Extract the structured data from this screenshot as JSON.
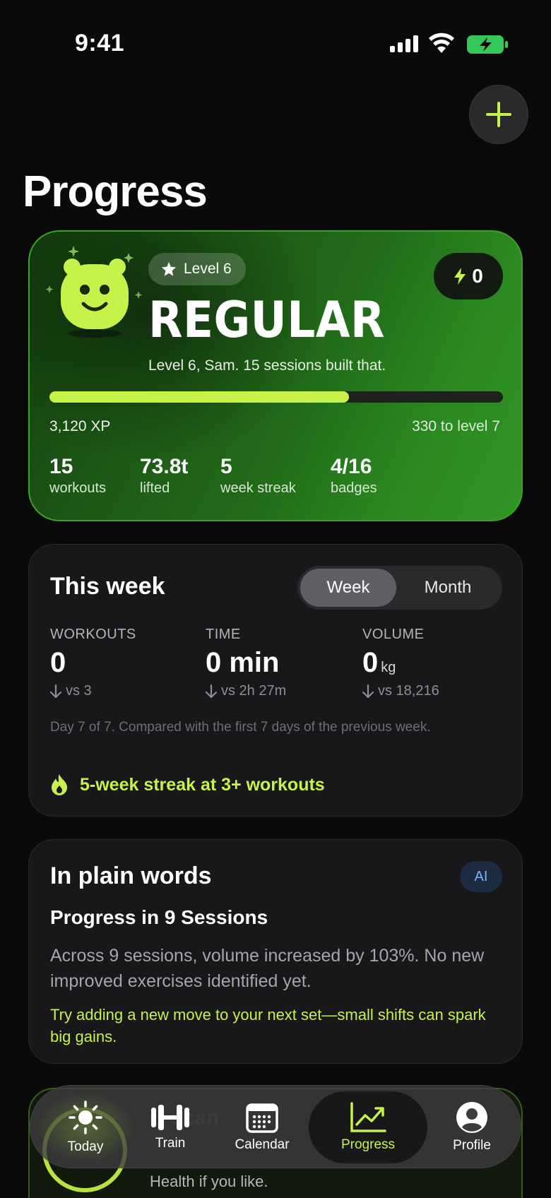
{
  "status_bar": {
    "time": "9:41"
  },
  "page": {
    "title": "Progress"
  },
  "level_card": {
    "level_label": "Level 6",
    "energy_count": "0",
    "rank": "REGULAR",
    "subtitle": "Level 6, Sam. 15 sessions built that.",
    "xp_progress_fraction": 0.66,
    "xp_text": "3,120 XP",
    "xp_to_next": "330 to level 7",
    "stats": [
      {
        "value": "15",
        "label": "workouts"
      },
      {
        "value": "73.8t",
        "label": "lifted"
      },
      {
        "value": "5",
        "label": "week streak"
      },
      {
        "value": "4/16",
        "label": "badges"
      }
    ]
  },
  "week_card": {
    "title": "This week",
    "segments": {
      "week": "Week",
      "month": "Month",
      "selected": "Week"
    },
    "metrics": [
      {
        "header": "WORKOUTS",
        "value": "0",
        "unit": "",
        "delta": "vs 3"
      },
      {
        "header": "TIME",
        "value": "0 min",
        "unit": "",
        "delta": "vs 2h 27m"
      },
      {
        "header": "VOLUME",
        "value": "0",
        "unit": "kg",
        "delta": "vs 18,216"
      }
    ],
    "note": "Day 7 of 7. Compared with the first 7 days of the previous week.",
    "streak": "5-week streak at 3+ workouts"
  },
  "ai_card": {
    "title": "In plain words",
    "badge": "AI",
    "subtitle": "Progress in 9 Sessions",
    "body": "Across 9 sessions, volume increased by 103%. No new improved exercises identified yet.",
    "tip": "Try adding a new move to your next set—small shifts can spark big gains."
  },
  "ghost_card": {
    "title_fragment": "B",
    "title_fragment_2": "scan",
    "text": "Health if you like."
  },
  "tab_bar": {
    "items": [
      {
        "label": "Today",
        "icon": "sun-icon"
      },
      {
        "label": "Train",
        "icon": "dumbbell-icon"
      },
      {
        "label": "Calendar",
        "icon": "calendar-icon"
      },
      {
        "label": "Progress",
        "icon": "trend-chart-icon"
      },
      {
        "label": "Profile",
        "icon": "person-icon"
      }
    ],
    "active": "Progress"
  },
  "colors": {
    "accent": "#c6f24a",
    "card": "#18181a",
    "background": "#0a0a0a",
    "ai_badge": "#7eb3ff"
  }
}
